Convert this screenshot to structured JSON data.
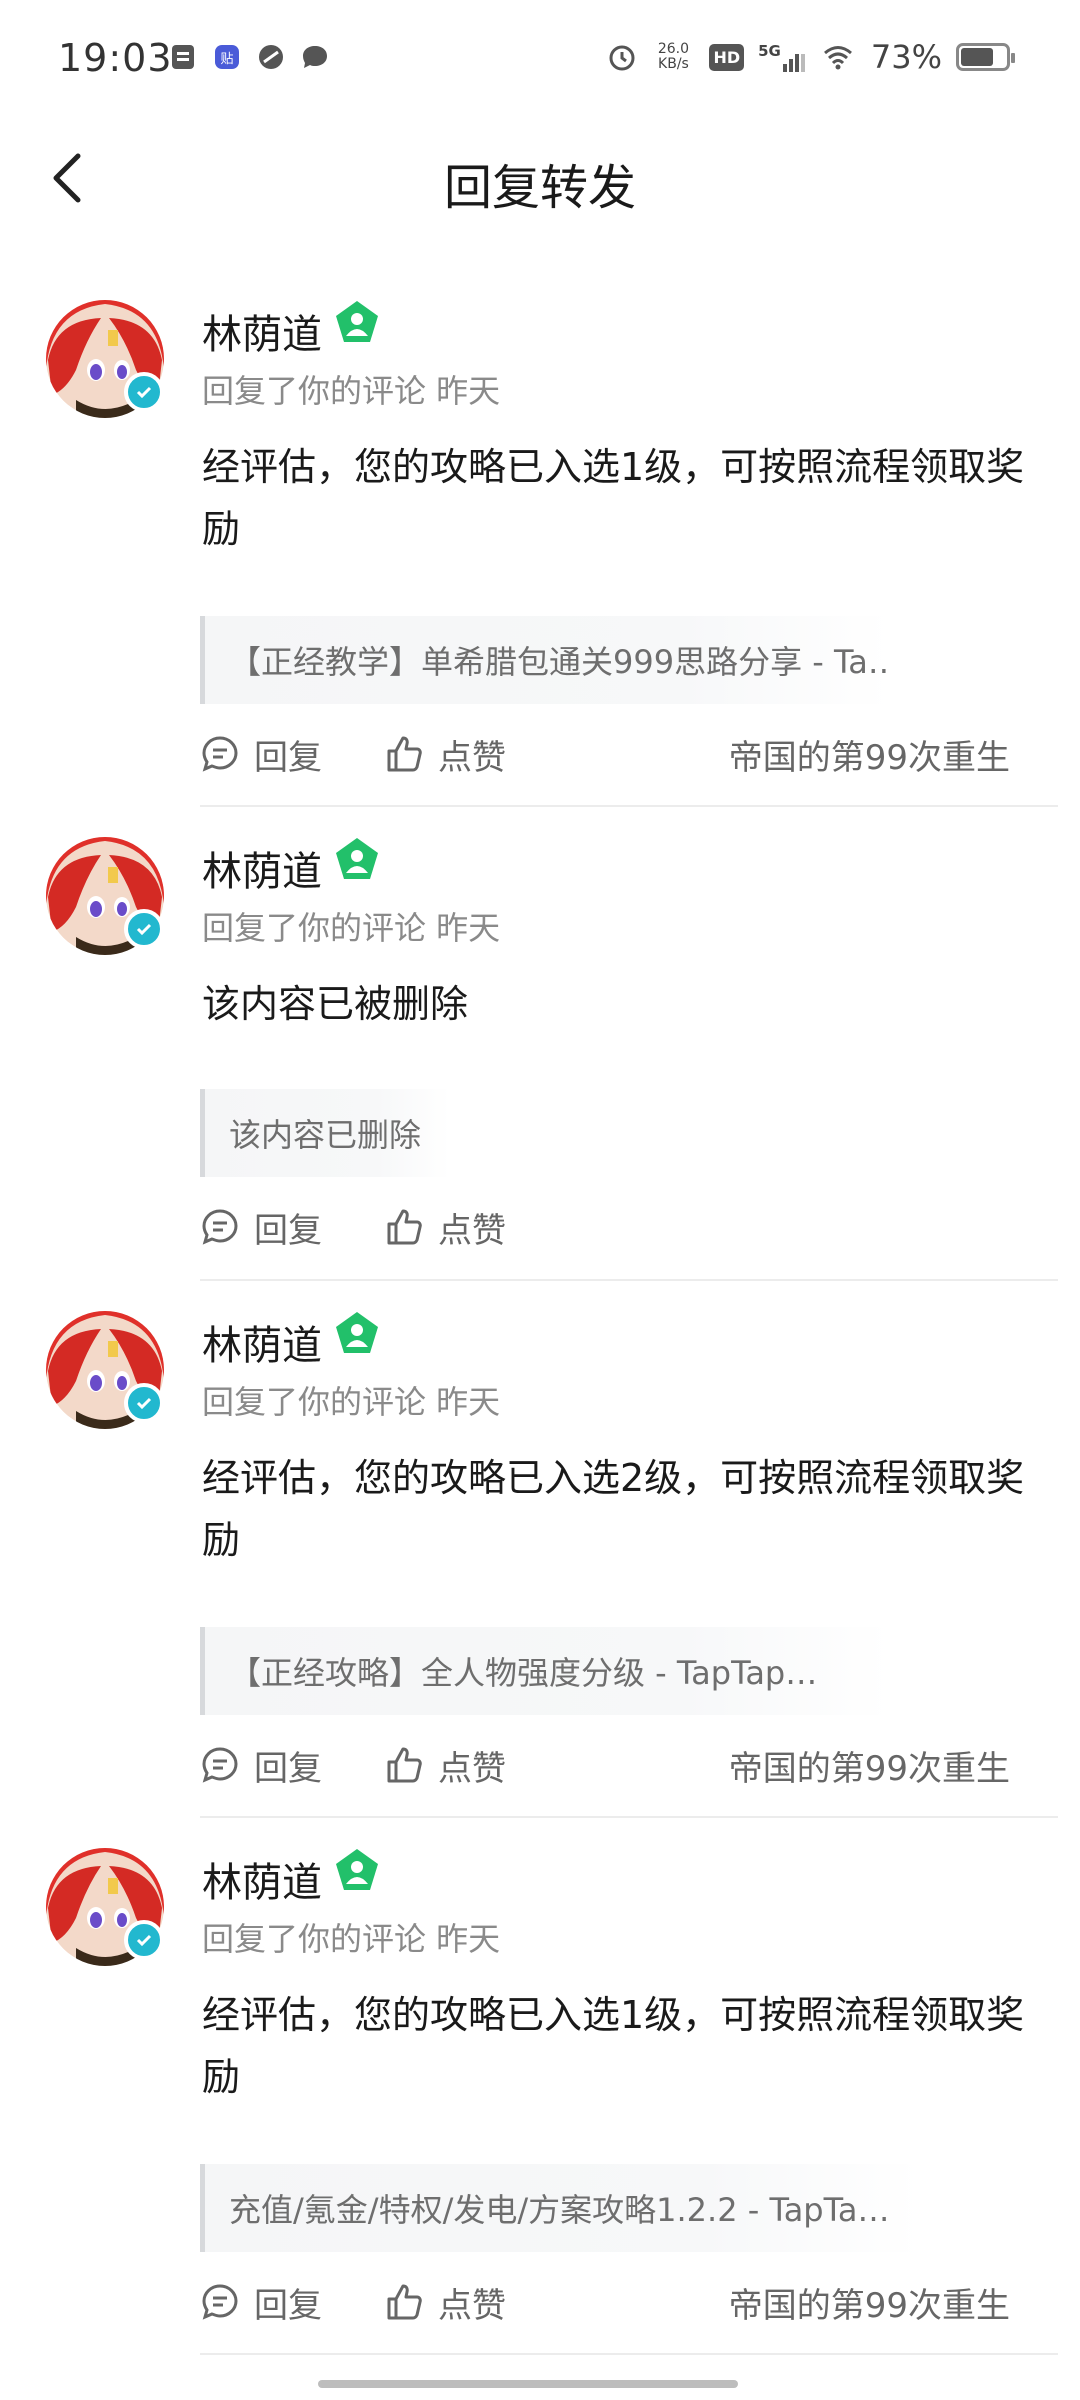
{
  "status_bar": {
    "time": "19:03",
    "net_speed_value": "26.0",
    "net_speed_unit": "KB/s",
    "hd": "HD",
    "signal": "5G",
    "battery": "73%",
    "battery_level": 0.73
  },
  "header": {
    "title": "回复转发"
  },
  "colors": {
    "accent": "#22c06a",
    "verified": "#22b8cf",
    "avatar_hair": "#e0302a"
  },
  "items": [
    {
      "user": "林荫道",
      "meta": "回复了你的评论 昨天",
      "content": "经评估，您的攻略已入选1级，可按照流程领取奖励",
      "quote": "【正经教学】单希腊包通关999思路分享 - Ta…",
      "reply": "回复",
      "like": "点赞",
      "source": "帝国的第99次重生"
    },
    {
      "user": "林荫道",
      "meta": "回复了你的评论 昨天",
      "content": "该内容已被删除",
      "quote": "该内容已删除",
      "reply": "回复",
      "like": "点赞",
      "source": ""
    },
    {
      "user": "林荫道",
      "meta": "回复了你的评论 昨天",
      "content": "经评估，您的攻略已入选2级，可按照流程领取奖励",
      "quote": "【正经攻略】全人物强度分级 - TapTap…",
      "reply": "回复",
      "like": "点赞",
      "source": "帝国的第99次重生"
    },
    {
      "user": "林荫道",
      "meta": "回复了你的评论 昨天",
      "content": "经评估，您的攻略已入选1级，可按照流程领取奖励",
      "quote": "充值/氪金/特权/发电/方案攻略1.2.2 - TapTa…",
      "reply": "回复",
      "like": "点赞",
      "source": "帝国的第99次重生"
    }
  ]
}
